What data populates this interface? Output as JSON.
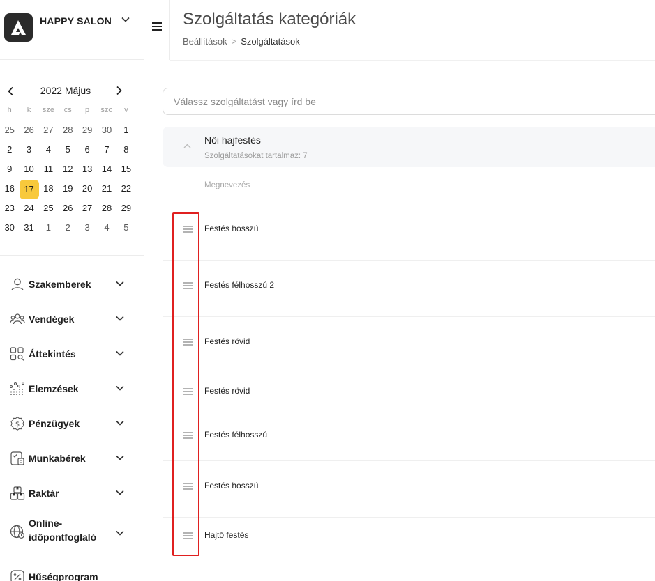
{
  "brand": {
    "name": "HAPPY SALON"
  },
  "calendar": {
    "title": "2022 Május",
    "weekdays": [
      "h",
      "k",
      "sze",
      "cs",
      "p",
      "szo",
      "v"
    ],
    "weeks": [
      [
        "25",
        "26",
        "27",
        "28",
        "29",
        "30",
        "1"
      ],
      [
        "2",
        "3",
        "4",
        "5",
        "6",
        "7",
        "8"
      ],
      [
        "9",
        "10",
        "11",
        "12",
        "13",
        "14",
        "15"
      ],
      [
        "16",
        "17",
        "18",
        "19",
        "20",
        "21",
        "22"
      ],
      [
        "23",
        "24",
        "25",
        "26",
        "27",
        "28",
        "29"
      ],
      [
        "30",
        "31",
        "1",
        "2",
        "3",
        "4",
        "5"
      ]
    ],
    "selected": "17",
    "highlight_color": "#f8c93c"
  },
  "sidebar": {
    "items": [
      {
        "label": "Szakemberek",
        "icon": "user-icon"
      },
      {
        "label": "Vendégek",
        "icon": "users-group-icon"
      },
      {
        "label": "Áttekintés",
        "icon": "grid-search-icon"
      },
      {
        "label": "Elemzések",
        "icon": "analytics-icon"
      },
      {
        "label": "Pénzügyek",
        "icon": "dollar-badge-icon"
      },
      {
        "label": "Munkabérek",
        "icon": "payroll-icon"
      },
      {
        "label": "Raktár",
        "icon": "warehouse-boxes-icon"
      },
      {
        "label": "Online-\nidőpontfoglaló",
        "icon": "globe-booking-icon"
      },
      {
        "label": "Hűségprogram",
        "icon": "percent-icon"
      }
    ]
  },
  "header": {
    "title": "Szolgáltatás kategóriák",
    "breadcrumb": {
      "parent": "Beállítások",
      "separator": ">",
      "current": "Szolgáltatások"
    }
  },
  "search": {
    "placeholder": "Válassz szolgáltatást vagy írd be"
  },
  "category": {
    "name": "Női hajfestés",
    "count_text": "Szolgáltatásokat tartalmaz: 7",
    "column_header": "Megnevezés",
    "services": [
      "Festés hosszú",
      "Festés félhosszú 2",
      "Festés rövid",
      "Festés rövid",
      "Festés félhosszú",
      "Festés hosszú",
      "Hajtő festés"
    ]
  },
  "colors": {
    "highlight_border": "#e02020",
    "card_bg": "#f6f7f9"
  }
}
